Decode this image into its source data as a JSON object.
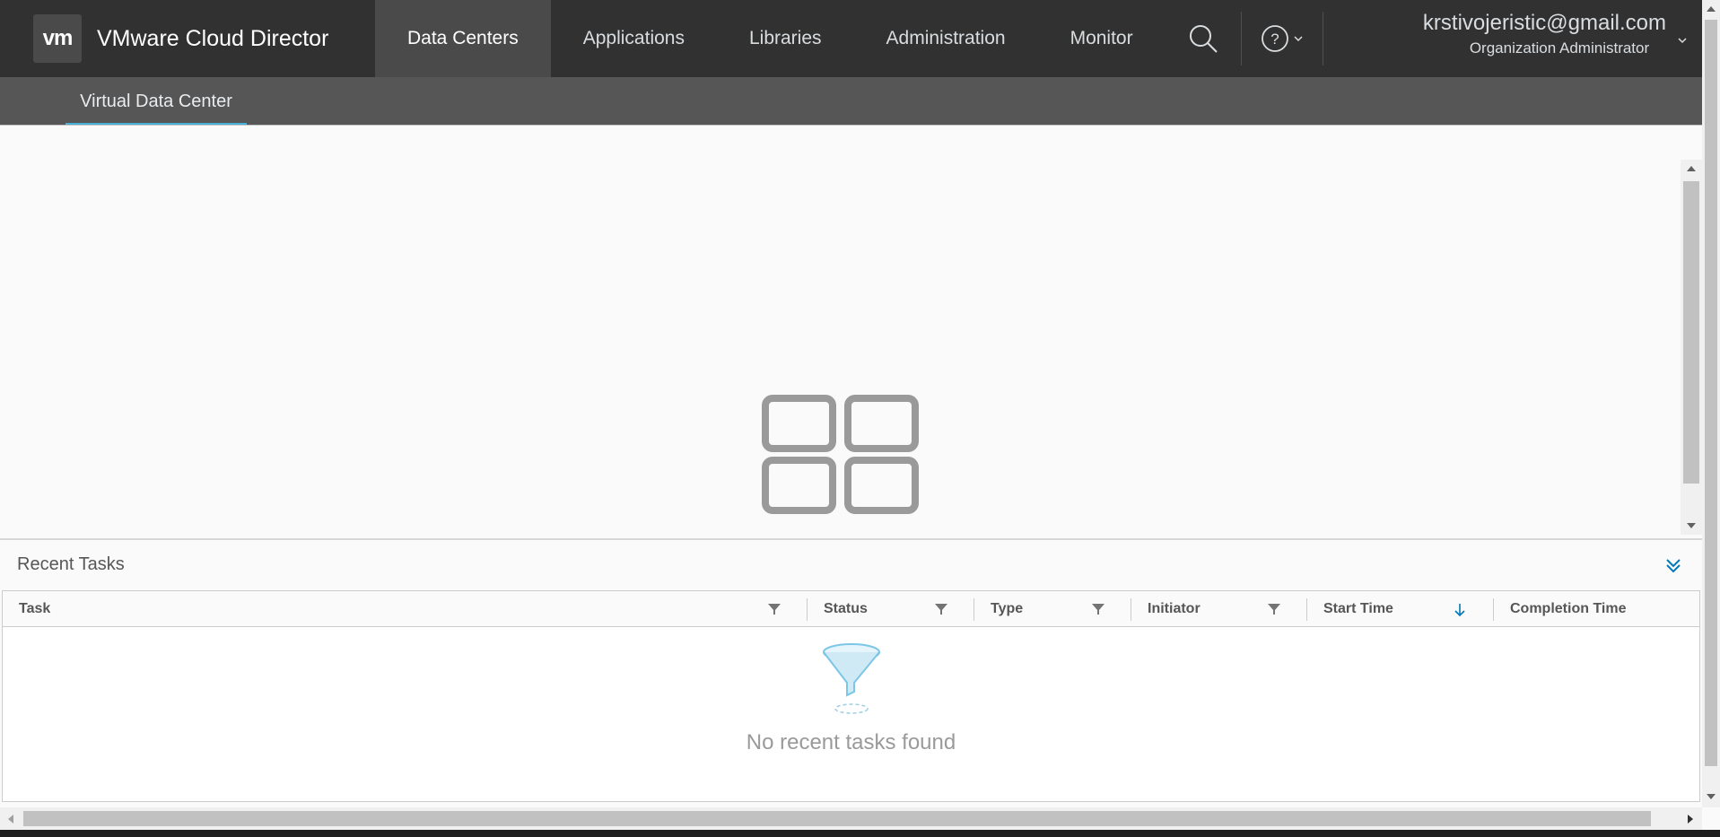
{
  "header": {
    "logo_text": "vm",
    "app_title": "VMware Cloud Director",
    "nav": [
      {
        "label": "Data Centers",
        "active": true
      },
      {
        "label": "Applications",
        "active": false
      },
      {
        "label": "Libraries",
        "active": false
      },
      {
        "label": "Administration",
        "active": false
      },
      {
        "label": "Monitor",
        "active": false
      }
    ],
    "user_email": "krstivojeristic@gmail.com",
    "user_role": "Organization Administrator"
  },
  "subnav": {
    "tab_label": "Virtual Data Center"
  },
  "recent_tasks": {
    "title": "Recent Tasks",
    "columns": [
      {
        "label": "Task",
        "filter": true
      },
      {
        "label": "Status",
        "filter": true
      },
      {
        "label": "Type",
        "filter": true
      },
      {
        "label": "Initiator",
        "filter": true
      },
      {
        "label": "Start Time",
        "sort": "descending"
      },
      {
        "label": "Completion Time"
      }
    ],
    "empty_message": "No recent tasks found"
  },
  "colors": {
    "header_bg": "#313131",
    "active_nav_bg": "#4a4a4a",
    "subnav_bg": "#565656",
    "accent": "#49afd9"
  },
  "icons": [
    "vmware-logo-icon",
    "search-icon",
    "help-icon",
    "chevron-down-icon",
    "data-center-grid-icon",
    "collapse-chevrons-icon",
    "filter-icon",
    "sort-arrow-down-icon",
    "empty-funnel-icon"
  ]
}
